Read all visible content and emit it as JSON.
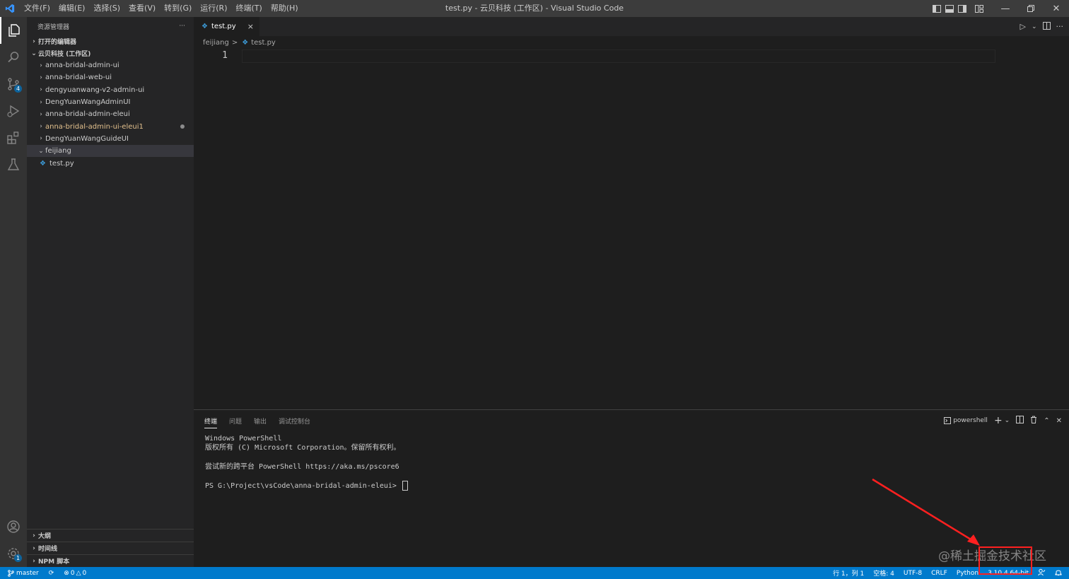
{
  "menu": [
    "文件(F)",
    "编辑(E)",
    "选择(S)",
    "查看(V)",
    "转到(G)",
    "运行(R)",
    "终端(T)",
    "帮助(H)"
  ],
  "window_title": "test.py - 云贝科技 (工作区) - Visual Studio Code",
  "activity": {
    "scm_badge": "4",
    "settings_badge": "1"
  },
  "sidebar": {
    "header": "资源管理器",
    "more": "···",
    "open_editors": "打开的编辑器",
    "workspace": "云贝科技 (工作区)",
    "folders": [
      {
        "label": "anna-bridal-admin-ui"
      },
      {
        "label": "anna-bridal-web-ui"
      },
      {
        "label": "dengyuanwang-v2-admin-ui"
      },
      {
        "label": "DengYuanWangAdminUI"
      },
      {
        "label": "anna-bridal-admin-eleui"
      },
      {
        "label": "anna-bridal-admin-ui-eleui1"
      },
      {
        "label": "DengYuanWangGuideUI"
      },
      {
        "label": "feijiang"
      }
    ],
    "file": "test.py",
    "outline": "大纲",
    "timeline": "时间线",
    "npm": "NPM 脚本"
  },
  "tab": {
    "label": "test.py",
    "close": "×"
  },
  "breadcrumb": {
    "folder": "feijiang",
    "sep": ">",
    "file": "test.py"
  },
  "editor": {
    "line_number": "1"
  },
  "panel": {
    "tabs": [
      "终端",
      "问题",
      "输出",
      "调试控制台"
    ],
    "shell": "powershell",
    "terminal_lines": [
      "Windows PowerShell",
      "版权所有 (C) Microsoft Corporation。保留所有权利。",
      "",
      "尝试新的跨平台 PowerShell https://aka.ms/pscore6",
      "",
      "PS G:\\Project\\vsCode\\anna-bridal-admin-eleui> "
    ]
  },
  "status": {
    "branch": "master",
    "errors": "0",
    "warnings": "0",
    "position": "行 1，列 1",
    "spaces": "空格: 4",
    "encoding": "UTF-8",
    "eol": "CRLF",
    "language": "Python",
    "interpreter": "3.10.4 64-bit"
  },
  "watermark": "@稀土掘金技术社区",
  "colors": {
    "accent": "#007acc",
    "annotation": "#ff2020"
  }
}
